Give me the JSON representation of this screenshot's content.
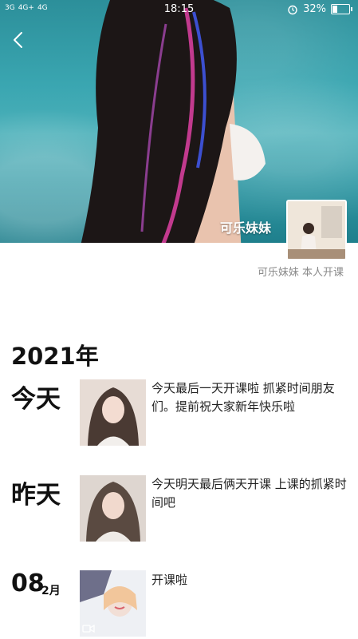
{
  "status_bar": {
    "signal_left": "3G",
    "signal_mid": "4G+",
    "signal_right": "4G",
    "time": "18:15",
    "battery": "32%",
    "battery_level": 0.32
  },
  "profile": {
    "cover_name": "可乐妹妹",
    "signature": "可乐妹妹 本人开课"
  },
  "timeline": {
    "year": "2021年",
    "posts": [
      {
        "day": "今天",
        "text": "今天最后一天开课啦 抓紧时间朋友们。提前祝大家新年快乐啦"
      },
      {
        "day": "昨天",
        "text": "今天明天最后俩天开课 上课的抓紧时间吧"
      },
      {
        "day_num": "08",
        "month": "2月",
        "text": "开课啦"
      }
    ]
  }
}
